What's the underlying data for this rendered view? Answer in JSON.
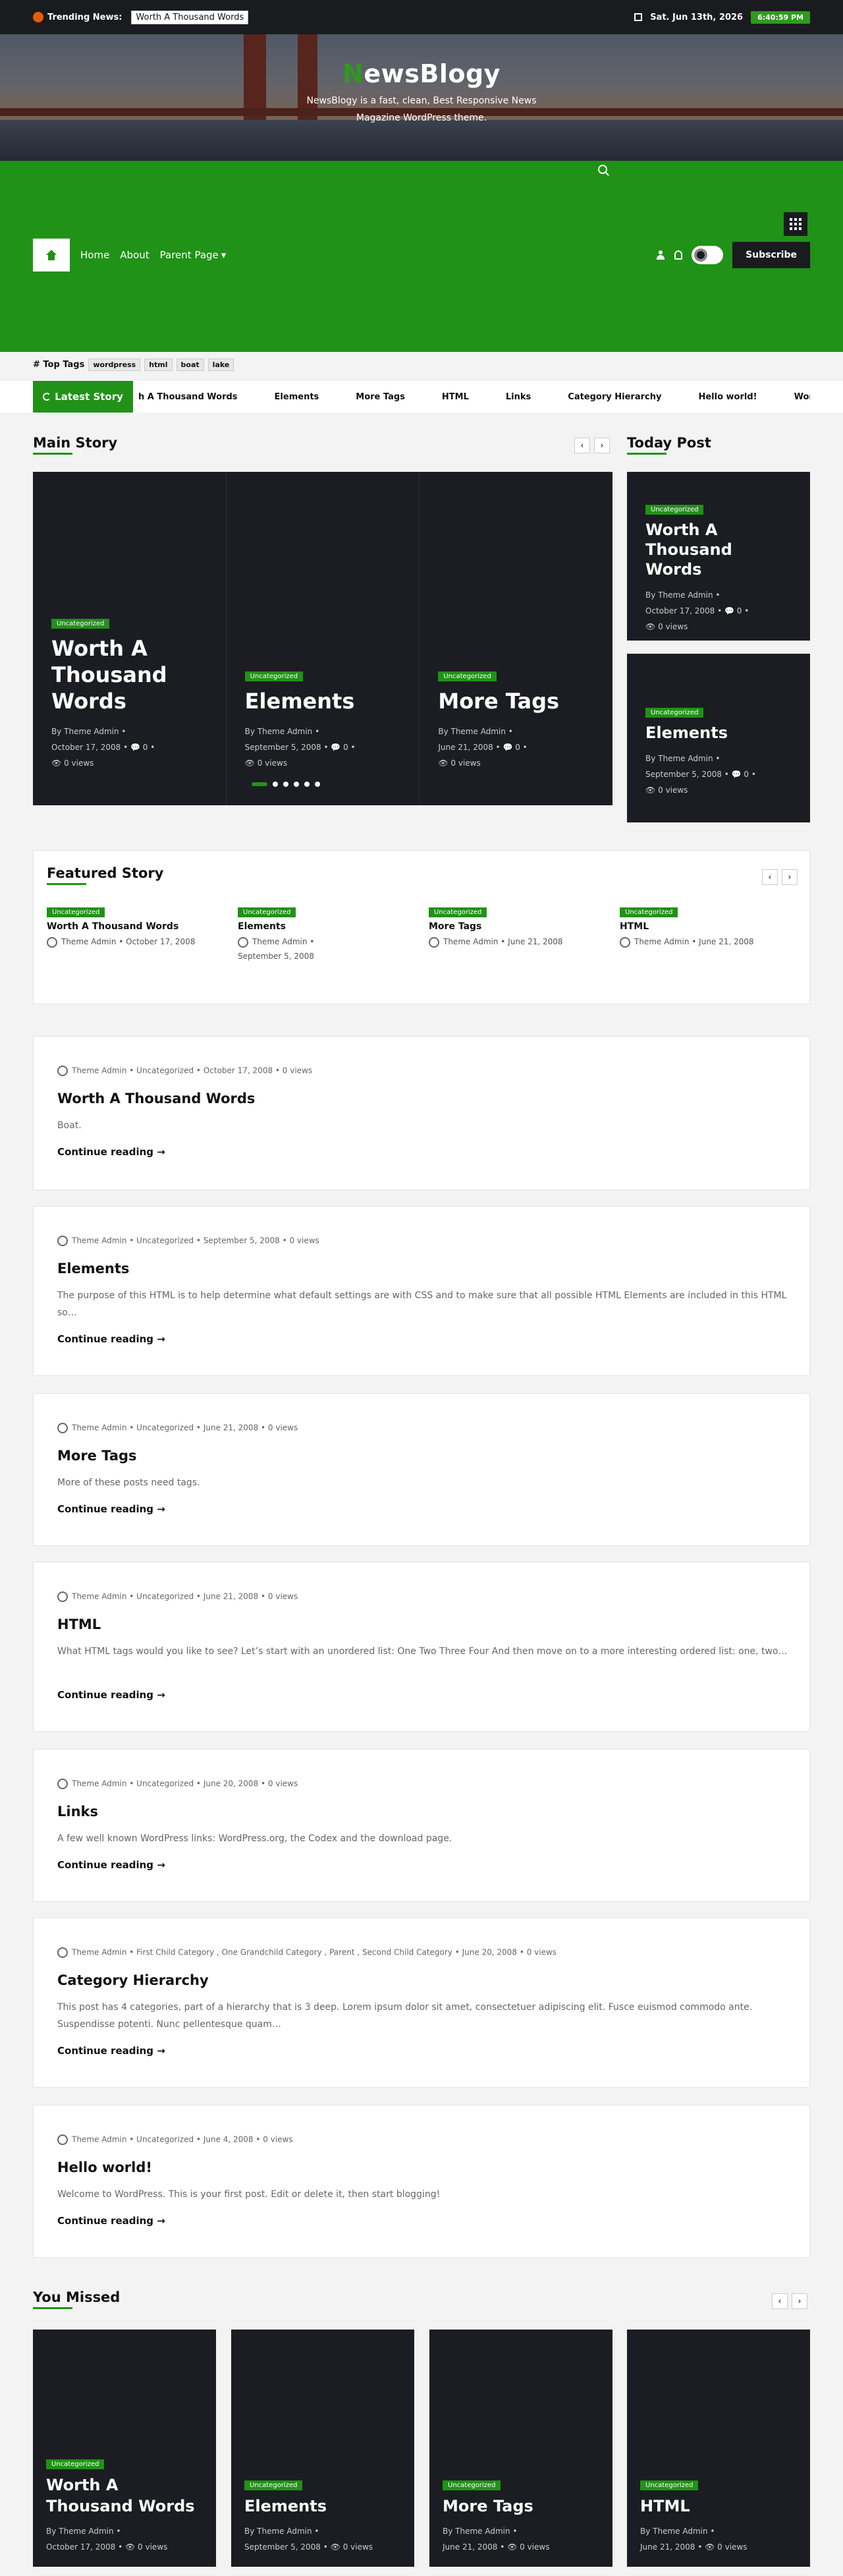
{
  "topbar": {
    "trending_label": "Trending News:",
    "trending_item": "Worth A Thousand Words",
    "date": "Sat. Jun 13th, 2026",
    "time": "6:40:59 PM"
  },
  "header": {
    "logo": "ewsBlogy",
    "logo_initial": "N",
    "tagline": "NewsBlogy is a fast, clean, Best Responsive News Magazine WordPress theme."
  },
  "nav": {
    "items": [
      "Home",
      "About",
      "Parent Page"
    ],
    "subscribe": "Subscribe"
  },
  "tags": {
    "label": "# Top Tags",
    "items": [
      "wordpress",
      "html",
      "boat",
      "lake"
    ]
  },
  "latest": {
    "label": "Latest Story",
    "items": [
      "h A Thousand Words",
      "Elements",
      "More Tags",
      "HTML",
      "Links",
      "Category Hierarchy",
      "Hello world!",
      "Wor"
    ]
  },
  "main_story": {
    "title": "Main Story",
    "slides": [
      {
        "cat": "Uncategorized",
        "title": "Worth A Thousand Words",
        "author": "By Theme Admin",
        "date": "October 17, 2008",
        "comments": "0",
        "views": "0 views"
      },
      {
        "cat": "Uncategorized",
        "title": "Elements",
        "author": "By Theme Admin",
        "date": "September 5, 2008",
        "comments": "0",
        "views": "0 views"
      },
      {
        "cat": "Uncategorized",
        "title": "More Tags",
        "author": "By Theme Admin",
        "date": "June 21, 2008",
        "comments": "0",
        "views": "0 views"
      }
    ]
  },
  "today_post": {
    "title": "Today Post",
    "items": [
      {
        "cat": "Uncategorized",
        "title": "Worth A Thousand Words",
        "author": "By Theme Admin",
        "date": "October 17, 2008",
        "comments": "0",
        "views": "0 views"
      },
      {
        "cat": "Uncategorized",
        "title": "Elements",
        "author": "By Theme Admin",
        "date": "September 5, 2008",
        "comments": "0",
        "views": "0 views"
      }
    ]
  },
  "featured": {
    "title": "Featured Story",
    "items": [
      {
        "cat": "Uncategorized",
        "title": "Worth A Thousand Words",
        "author": "Theme Admin",
        "date": "October 17, 2008"
      },
      {
        "cat": "Uncategorized",
        "title": "Elements",
        "author": "Theme Admin",
        "date": "September 5, 2008"
      },
      {
        "cat": "Uncategorized",
        "title": "More Tags",
        "author": "Theme Admin",
        "date": "June 21, 2008"
      },
      {
        "cat": "Uncategorized",
        "title": "HTML",
        "author": "Theme Admin",
        "date": "June 21, 2008"
      }
    ]
  },
  "posts": [
    {
      "meta": "Theme Admin  •  Uncategorized  •  October 17, 2008  •  0 views",
      "title": "Worth A Thousand Words",
      "excerpt": "Boat.",
      "more": "Continue reading →"
    },
    {
      "meta": "Theme Admin  •  Uncategorized  •  September 5, 2008  •  0 views",
      "title": "Elements",
      "excerpt": "The purpose of this HTML is to help determine what default settings are with CSS and to make sure that all possible HTML Elements are included in this HTML so…",
      "more": "Continue reading →"
    },
    {
      "meta": "Theme Admin  •  Uncategorized  •  June 21, 2008  •  0 views",
      "title": "More Tags",
      "excerpt": "More of these posts need tags.",
      "more": "Continue reading →"
    },
    {
      "meta": "Theme Admin  •  Uncategorized  •  June 21, 2008  •  0 views",
      "title": "HTML",
      "excerpt": "What HTML tags would you like to see? Let’s start with an unordered list: One Two Three Four And then move on to a more interesting ordered list: one, two…",
      "more": "Continue reading →"
    },
    {
      "meta": "Theme Admin  •  Uncategorized  •  June 20, 2008  •  0 views",
      "title": "Links",
      "excerpt": "A few well known WordPress links: WordPress.org, the Codex and the download page.",
      "more": "Continue reading →"
    },
    {
      "meta": "Theme Admin  •  First Child Category , One Grandchild Category , Parent , Second Child Category  •  June 20, 2008  •  0 views",
      "title": "Category Hierarchy",
      "excerpt": "This post has 4 categories, part of a hierarchy that is 3 deep. Lorem ipsum dolor sit amet, consectetuer adipiscing elit. Fusce euismod commodo ante. Suspendisse potenti. Nunc pellentesque quam…",
      "more": "Continue reading →"
    },
    {
      "meta": "Theme Admin  •  Uncategorized  •  June 4, 2008  •  0 views",
      "title": "Hello world!",
      "excerpt": "Welcome to WordPress. This is your first post. Edit or delete it, then start blogging!",
      "more": "Continue reading →"
    }
  ],
  "you_missed": {
    "title": "You Missed",
    "items": [
      {
        "cat": "Uncategorized",
        "title": "Worth A Thousand Words",
        "author": "By Theme Admin",
        "date": "October 17, 2008",
        "views": "0 views"
      },
      {
        "cat": "Uncategorized",
        "title": "Elements",
        "author": "By Theme Admin",
        "date": "September 5, 2008",
        "views": "0 views"
      },
      {
        "cat": "Uncategorized",
        "title": "More Tags",
        "author": "By Theme Admin",
        "date": "June 21, 2008",
        "views": "0 views"
      },
      {
        "cat": "Uncategorized",
        "title": "HTML",
        "author": "By Theme Admin",
        "date": "June 21, 2008",
        "views": "0 views"
      }
    ]
  },
  "colors": {
    "accent": "#209217",
    "dark": "#1c1d22"
  }
}
